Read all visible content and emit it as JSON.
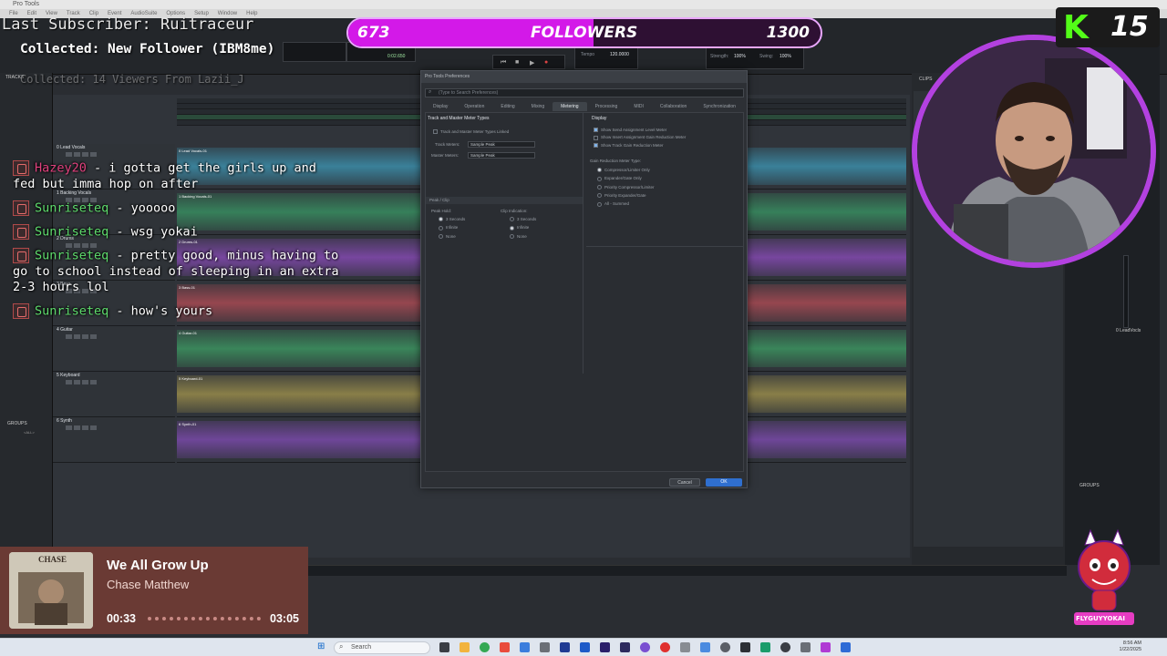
{
  "daw": {
    "app_title": "Pro Tools",
    "menu": [
      "File",
      "Edit",
      "View",
      "Track",
      "Clip",
      "Event",
      "AudioSuite",
      "Options",
      "Setup",
      "Window",
      "Help"
    ],
    "counter": "0:00.170",
    "counter2": "0:02.650",
    "tempo_label": "Tempo",
    "tempo_value": "120.0000",
    "strength_label": "Strength:",
    "strength_value": "100%",
    "swing_label": "Swing:",
    "swing_value": "100%",
    "tracks": [
      {
        "name": "0 Lead Vocals",
        "clip": "0 Lead Vocals-01",
        "color": "#3fa7c9"
      },
      {
        "name": "1 Backing Vocals",
        "clip": "1 Backing Vocals-01",
        "color": "#3aa66b"
      },
      {
        "name": "2 Drums",
        "clip": "2 Drums-01",
        "color": "#9b4fd1"
      },
      {
        "name": "3 Bass",
        "clip": "3 Bass-01",
        "color": "#c9505a"
      },
      {
        "name": "4 Guitar",
        "clip": "4 Guitar-01",
        "color": "#3fae6a"
      },
      {
        "name": "5 Keyboard",
        "clip": "5 Keyboard-01",
        "color": "#b5a34f"
      },
      {
        "name": "6 Synth",
        "clip": "6 Synth-01",
        "color": "#8e4fc8"
      }
    ],
    "left_panel_groups": "GROUPS",
    "left_panel_all": "<ALL>",
    "right_panel_clips": "CLIPS",
    "right_panel_groups": "GROUPS",
    "mixer_track_label": "0 LeadVocls",
    "tracks_label": "TRACKS"
  },
  "preferences": {
    "title": "Pro Tools Preferences",
    "search_placeholder": "(Type to Search Preferences)",
    "tabs": [
      "Display",
      "Operation",
      "Editing",
      "Mixing",
      "Metering",
      "Processing",
      "MIDI",
      "Collaboration",
      "Synchronization"
    ],
    "active_tab": "Metering",
    "section_meter_types": "Track and Master Meter Types",
    "linked_label": "Track and Master Meter Types Linked",
    "track_meters_label": "Track Meters:",
    "track_meters_value": "Sample Peak",
    "master_meters_label": "Master Meters:",
    "master_meters_value": "Sample Peak",
    "section_display": "Display",
    "display_opts": [
      {
        "label": "Show Send Assignment Level Meter",
        "checked": true
      },
      {
        "label": "Show Insert Assignment Gain Reduction Meter",
        "checked": false
      },
      {
        "label": "Show Track Gain Reduction Meter",
        "checked": true
      }
    ],
    "gr_type_label": "Gain Reduction Meter Type:",
    "gr_options": [
      {
        "label": "Compressor/Limiter Only",
        "selected": true
      },
      {
        "label": "Expander/Gate Only",
        "selected": false
      },
      {
        "label": "Priority Compressor/Limiter",
        "selected": false
      },
      {
        "label": "Priority Expander/Gate",
        "selected": false
      },
      {
        "label": "All - Summed",
        "selected": false
      }
    ],
    "section_peak": "Peak / Clip",
    "peak_hold_label": "Peak Hold:",
    "peak_hold_opts": [
      {
        "label": "3 Seconds",
        "selected": true
      },
      {
        "label": "Infinite",
        "selected": false
      },
      {
        "label": "None",
        "selected": false
      }
    ],
    "clip_ind_label": "Clip Indication:",
    "clip_ind_opts": [
      {
        "label": "3 Seconds",
        "selected": false
      },
      {
        "label": "Infinite",
        "selected": true
      },
      {
        "label": "None",
        "selected": false
      }
    ],
    "cancel_label": "Cancel",
    "ok_label": "OK"
  },
  "overlay": {
    "last_sub": "Last Subscriber: Ruitraceur",
    "collected": "Collected: New Follower (IBM8me)",
    "collected_faded": "Collected: 14 Viewers From Lazii_J",
    "followers_current": "673",
    "followers_label": "FOLLOWERS",
    "followers_goal": "1300",
    "followers_progress": 0.52,
    "kick_count": "15",
    "chat": [
      {
        "user": "Hazey20",
        "color": "#e0407d",
        "text": " - i gotta get the girls up and fed but imma hop on after"
      },
      {
        "user": "Sunriseteq",
        "color": "#5edc6c",
        "text": " - yooooo"
      },
      {
        "user": "Sunriseteq",
        "color": "#5edc6c",
        "text": " - wsg yokai"
      },
      {
        "user": "Sunriseteq",
        "color": "#5edc6c",
        "text": " - pretty good, minus having to go to school instead of sleeping in an extra 2-3 hours lol"
      },
      {
        "user": "Sunriseteq",
        "color": "#5edc6c",
        "text": " - how's yours"
      }
    ],
    "now_playing": {
      "title": "We All Grow Up",
      "artist": "Chase Matthew",
      "elapsed": "00:33",
      "duration": "03:05",
      "art_text": "CHASE"
    },
    "mascot_name": "FLYGUYYOKAI"
  },
  "taskbar": {
    "search_placeholder": "Search",
    "time": "8:56 AM",
    "date": "1/22/2025"
  }
}
